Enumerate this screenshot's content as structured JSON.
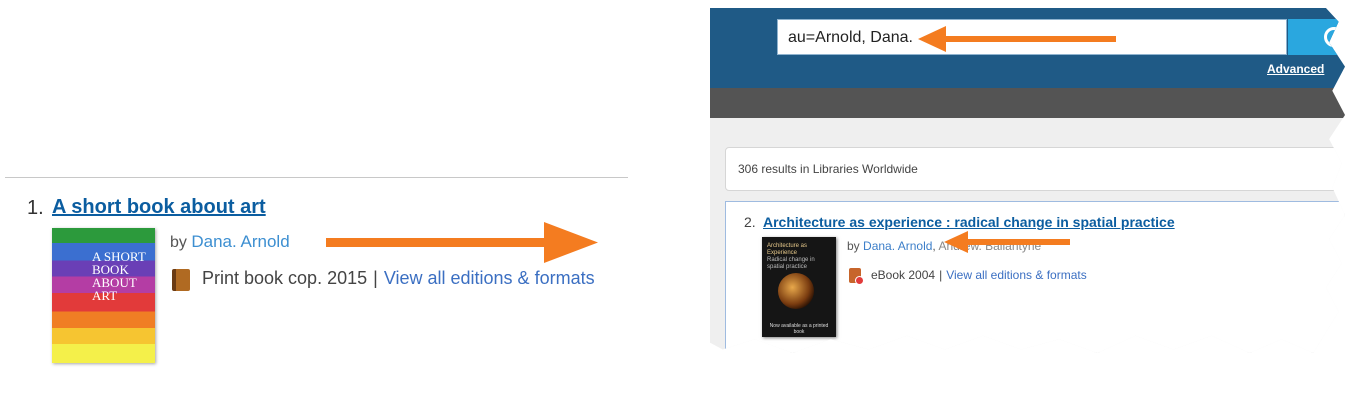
{
  "left": {
    "result_number": "1.",
    "title": "A short book about art",
    "by_prefix": "by",
    "author": "Dana. Arnold",
    "format": "Print book cop. 2015",
    "separator": "|",
    "editions_link": "View all editions & formats",
    "cover_text": "A SHORT BOOK ABOUT ART"
  },
  "right": {
    "search_value": "au=Arnold, Dana.",
    "advanced_link": "Advanced",
    "results_count": "306 results in Libraries Worldwide",
    "result": {
      "number": "2.",
      "title": "Architecture as experience : radical change in spatial practice",
      "by_prefix": "by",
      "author": "Dana. Arnold",
      "second_author": "Andrew. Ballantyne",
      "format": "eBook 2004",
      "separator": "|",
      "editions_link": "View all editions & formats",
      "cover_title": "Architecture as Experience",
      "cover_subtitle": "Radical change in spatial practice",
      "cover_footer": "Now available as a printed book"
    }
  },
  "colors": {
    "link": "#0b5da0",
    "arrow": "#f47c20",
    "header": "#1f5a86",
    "search_button": "#2aa7df"
  }
}
